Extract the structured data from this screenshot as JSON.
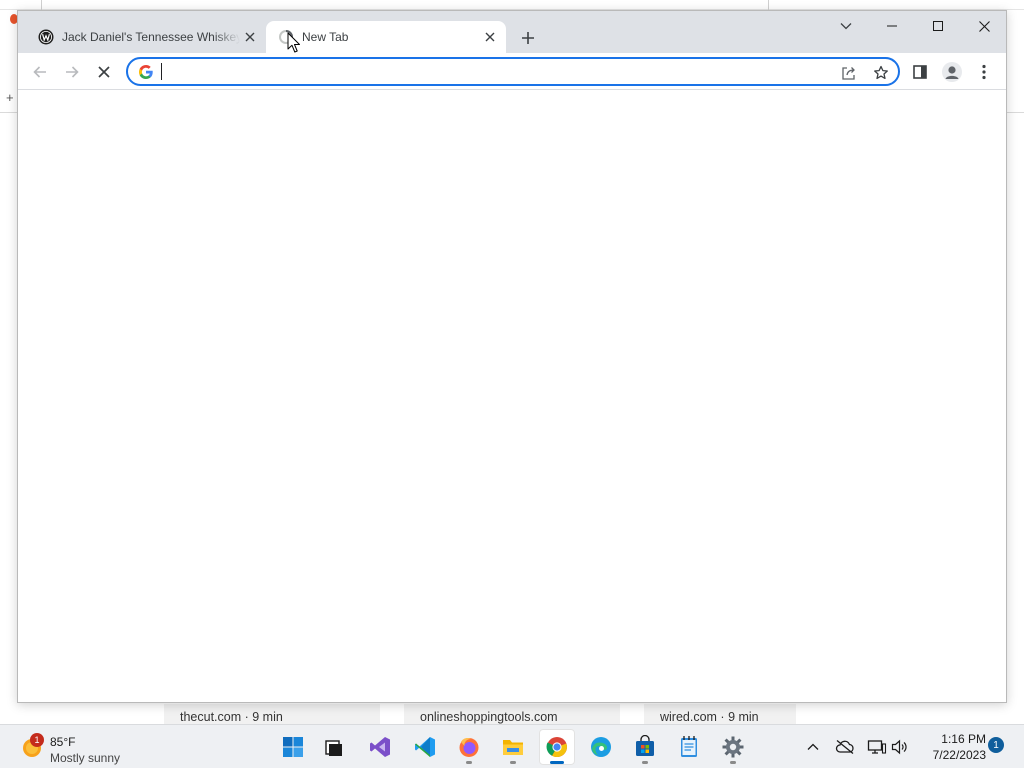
{
  "browser": {
    "tabs": [
      {
        "title": "Jack Daniel's Tennessee Whiskey",
        "favicon": "jack-daniels-logo",
        "active": false
      },
      {
        "title": "New Tab",
        "favicon": "loading-spinner",
        "active": true
      }
    ],
    "omnibox": {
      "value": "",
      "placeholder": ""
    },
    "accent_color": "#1a73e8"
  },
  "background_page": {
    "cards": [
      {
        "text": "thecut.com · 9 min"
      },
      {
        "text": "onlineshoppingtools.com"
      },
      {
        "text": "wired.com · 9 min"
      }
    ]
  },
  "taskbar": {
    "weather": {
      "badge": "1",
      "temperature": "85°F",
      "condition": "Mostly sunny"
    },
    "apps": [
      {
        "name": "Start",
        "icon": "windows-start-icon"
      },
      {
        "name": "Task View",
        "icon": "task-view-icon"
      },
      {
        "name": "Visual Studio",
        "icon": "visual-studio-icon"
      },
      {
        "name": "Visual Studio Code",
        "icon": "vscode-icon"
      },
      {
        "name": "Firefox",
        "icon": "firefox-icon"
      },
      {
        "name": "File Explorer",
        "icon": "file-explorer-icon"
      },
      {
        "name": "Google Chrome",
        "icon": "chrome-icon",
        "active": true
      },
      {
        "name": "Microsoft Edge",
        "icon": "edge-icon"
      },
      {
        "name": "Microsoft Store",
        "icon": "store-icon"
      },
      {
        "name": "Notepad",
        "icon": "notepad-icon"
      },
      {
        "name": "Settings",
        "icon": "settings-icon"
      }
    ],
    "clock": {
      "time": "1:16 PM",
      "date": "7/22/2023"
    },
    "notifications": "1"
  }
}
